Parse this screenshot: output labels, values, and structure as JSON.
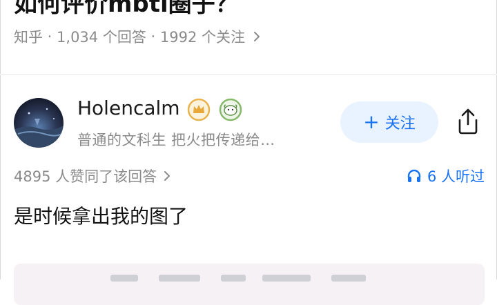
{
  "question": {
    "title": "如何评价mbti圈子？",
    "source": "知乎",
    "answers": "1,034 个回答",
    "followers": "1992 个关注"
  },
  "answer": {
    "author_name": "Holencalm",
    "author_bio": "普通的文科生  把火把传递给…",
    "follow_label": "关注",
    "upvote_text": "4895 人赞同了该回答",
    "listeners_text": "6 人听过",
    "content": "是时候拿出我的图了"
  },
  "colors": {
    "accent": "#1772f6",
    "follow_bg": "#e9f2ff",
    "meta_gray": "#8a8a8a",
    "image_card_bg": "#f6f1f4"
  },
  "icons": {
    "question_meta_chevron": "chevron-right-icon",
    "author_badge_1": "crown-badge-icon",
    "author_badge_2": "sheep-badge-icon",
    "follow_plus": "plus-icon",
    "share": "share-icon",
    "listeners": "headphones-icon"
  }
}
